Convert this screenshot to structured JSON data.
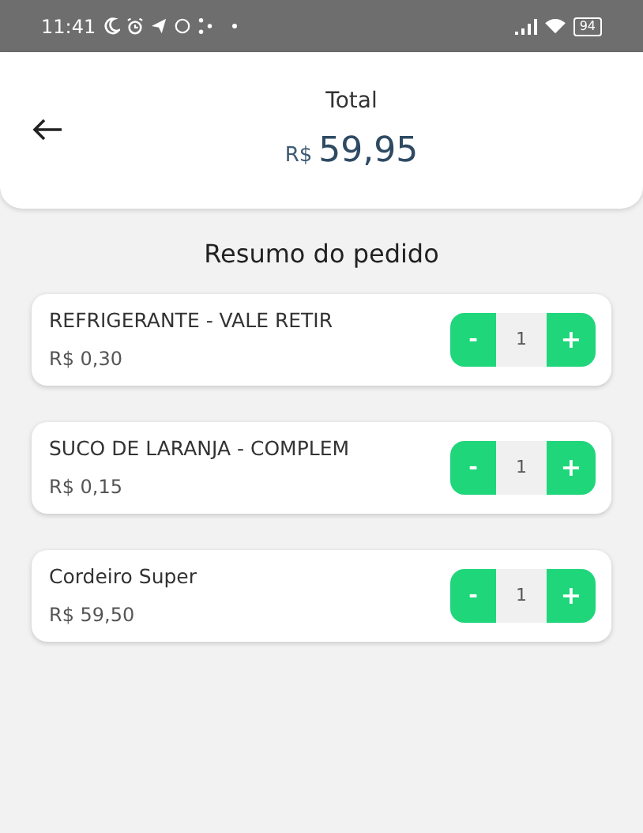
{
  "status_bar": {
    "time": "11:41",
    "battery": "94"
  },
  "header": {
    "label": "Total",
    "currency": "R$",
    "amount": "59,95"
  },
  "section_title": "Resumo do pedido",
  "items": [
    {
      "name": "REFRIGERANTE - VALE RETIR",
      "price": "R$ 0,30",
      "quantity": "1",
      "minus": "-",
      "plus": "+"
    },
    {
      "name": "SUCO DE LARANJA - COMPLEM",
      "price": "R$ 0,15",
      "quantity": "1",
      "minus": "-",
      "plus": "+"
    },
    {
      "name": "Cordeiro Super",
      "price": "R$ 59,50",
      "quantity": "1",
      "minus": "-",
      "plus": "+"
    }
  ]
}
